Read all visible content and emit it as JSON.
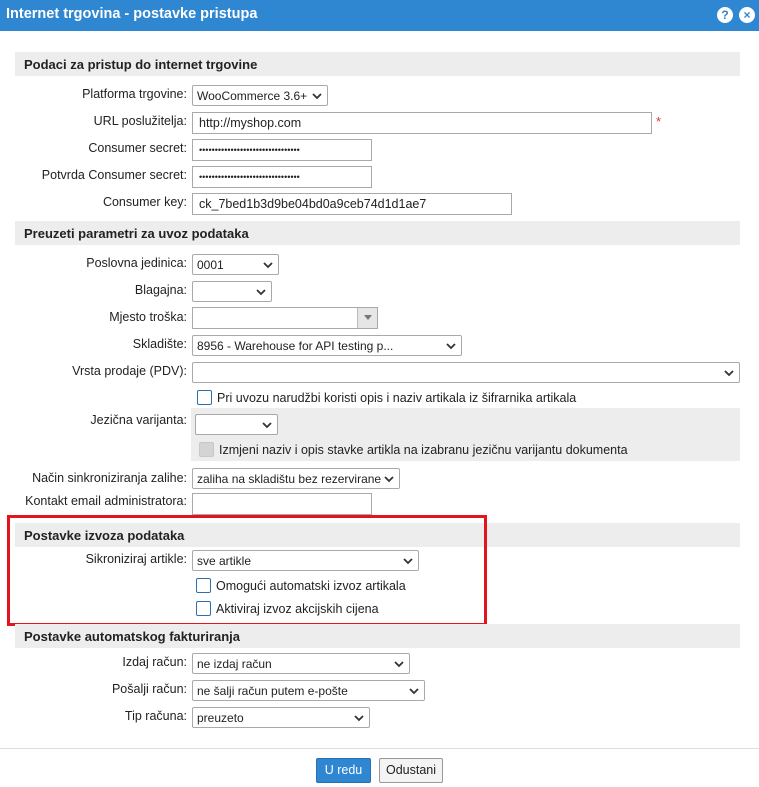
{
  "window": {
    "title": "Internet trgovina - postavke pristupa",
    "help_icon": "?",
    "close_icon": "×"
  },
  "sections": {
    "access": "Podaci za pristup do internet trgovine",
    "import": "Preuzeti parametri za uvoz podataka",
    "export": "Postavke izvoza podataka",
    "invoicing": "Postavke automatskog fakturiranja"
  },
  "access": {
    "platform_label": "Platforma trgovine:",
    "platform_value": "WooCommerce 3.6+",
    "url_label": "URL poslužitelja:",
    "url_value": "http://myshop.com",
    "required_mark": "*",
    "secret_label": "Consumer secret:",
    "secret_value": "••••••••••••••••••••••••••••••••",
    "secret_confirm_label": "Potvrda Consumer secret:",
    "secret_confirm_value": "••••••••••••••••••••••••••••••••",
    "key_label": "Consumer key:",
    "key_value": "ck_7bed1b3d9be04bd0a9ceb74d1d1ae7"
  },
  "import": {
    "unit_label": "Poslovna jedinica:",
    "unit_value": "0001",
    "cashbox_label": "Blagajna:",
    "cashbox_value": "",
    "cost_place_label": "Mjesto troška:",
    "cost_place_value": "",
    "warehouse_label": "Skladište:",
    "warehouse_value": "8956 - Warehouse for API testing p...",
    "sale_type_label": "Vrsta prodaje (PDV):",
    "sale_type_value": "",
    "use_catalog_label": "Pri uvozu narudžbi koristi opis i naziv artikala iz šifrarnika artikala",
    "language_label": "Jezična varijanta:",
    "language_value": "",
    "change_name_label": "Izmjeni naziv i opis stavke artikla na izabranu jezičnu varijantu dokumenta",
    "stock_sync_label": "Način sinkroniziranja zalihe:",
    "stock_sync_value": "zaliha na skladištu bez rezervirane",
    "admin_email_label": "Kontakt email administratora:",
    "admin_email_value": ""
  },
  "export": {
    "sync_label": "Sikroniziraj artikle:",
    "sync_value": "sve artikle",
    "auto_export_label": "Omogući automatski izvoz artikala",
    "promo_prices_label": "Aktiviraj izvoz akcijskih cijena"
  },
  "invoicing": {
    "issue_label": "Izdaj račun:",
    "issue_value": "ne izdaj račun",
    "send_label": "Pošalji račun:",
    "send_value": "ne šalji račun putem e-pošte",
    "type_label": "Tip računa:",
    "type_value": "preuzeto"
  },
  "footer": {
    "ok_label": "U redu",
    "cancel_label": "Odustani"
  },
  "colors": {
    "titlebar": "#2f86d1",
    "section_bg": "#ededed",
    "highlight": "#e3141b",
    "required": "#dd3333"
  }
}
